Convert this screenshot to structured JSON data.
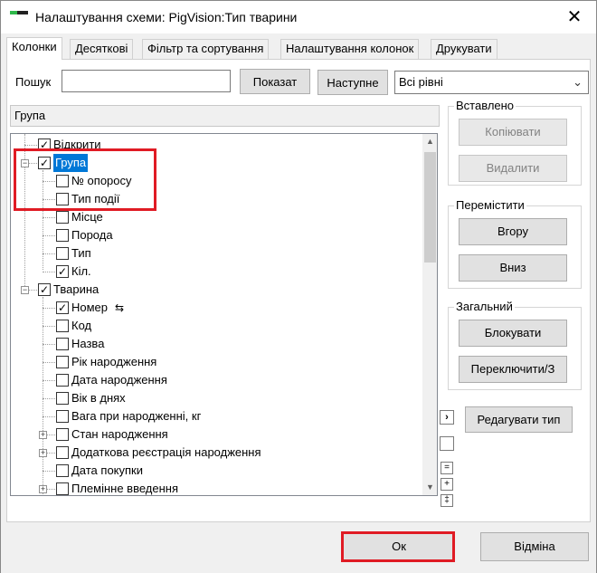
{
  "window": {
    "title": "Налаштування схеми: PigVision:Тип тварини",
    "close_glyph": "✕"
  },
  "tabs": [
    {
      "label": "Колонки",
      "active": true
    },
    {
      "label": "Десяткові",
      "active": false
    },
    {
      "label": "Фільтр та сортування",
      "active": false
    },
    {
      "label": "Налаштування колонок",
      "active": false
    },
    {
      "label": "Друкувати",
      "active": false
    }
  ],
  "search": {
    "label": "Пошук",
    "value": "",
    "show_button": "Показат",
    "next_button": "Наступне",
    "level_select": "Всі рівні"
  },
  "section_header": "Група",
  "tree": [
    {
      "label": "Відкрити",
      "checked": true,
      "level": 0,
      "expander": "",
      "partial": true
    },
    {
      "label": "Група",
      "checked": true,
      "level": 0,
      "expander": "−",
      "selected": true
    },
    {
      "label": "№ опоросу",
      "checked": false,
      "level": 1
    },
    {
      "label": "Тип події",
      "checked": false,
      "level": 1
    },
    {
      "label": "Місце",
      "checked": false,
      "level": 1
    },
    {
      "label": "Порода",
      "checked": false,
      "level": 1
    },
    {
      "label": "Тип",
      "checked": false,
      "level": 1
    },
    {
      "label": "Кіл.",
      "checked": true,
      "level": 1
    },
    {
      "label": "Тварина",
      "checked": true,
      "level": 0,
      "expander": "−"
    },
    {
      "label": "Номер",
      "checked": true,
      "level": 1,
      "extra_icon": "sort-icon"
    },
    {
      "label": "Код",
      "checked": false,
      "level": 1
    },
    {
      "label": "Назва",
      "checked": false,
      "level": 1
    },
    {
      "label": "Рік народження",
      "checked": false,
      "level": 1
    },
    {
      "label": "Дата народження",
      "checked": false,
      "level": 1
    },
    {
      "label": "Вік в днях",
      "checked": false,
      "level": 1
    },
    {
      "label": "Вага при народженні, кг",
      "checked": false,
      "level": 1
    },
    {
      "label": "Стан народження",
      "checked": false,
      "level": 1,
      "expander": "+"
    },
    {
      "label": "Додаткова реєстрація народження",
      "checked": false,
      "level": 1,
      "expander": "+"
    },
    {
      "label": "Дата покупки",
      "checked": false,
      "level": 1
    },
    {
      "label": "Племінне введення",
      "checked": false,
      "level": 1,
      "expander": "+"
    }
  ],
  "panels": {
    "insert": {
      "title": "Вставлено",
      "copy": "Копіювати",
      "delete": "Видалити"
    },
    "move": {
      "title": "Перемістити",
      "up": "Вгору",
      "down": "Вниз"
    },
    "general": {
      "title": "Загальний",
      "block": "Блокувати",
      "toggle": "Переключити/З"
    },
    "edit_type": "Редагувати тип",
    "arrow_glyph": "›",
    "small_buttons": [
      "=",
      "+",
      "‡"
    ]
  },
  "footer": {
    "ok": "Ок",
    "cancel": "Відміна"
  },
  "colors": {
    "highlight": "#e01b24",
    "selection": "#0078d7"
  }
}
